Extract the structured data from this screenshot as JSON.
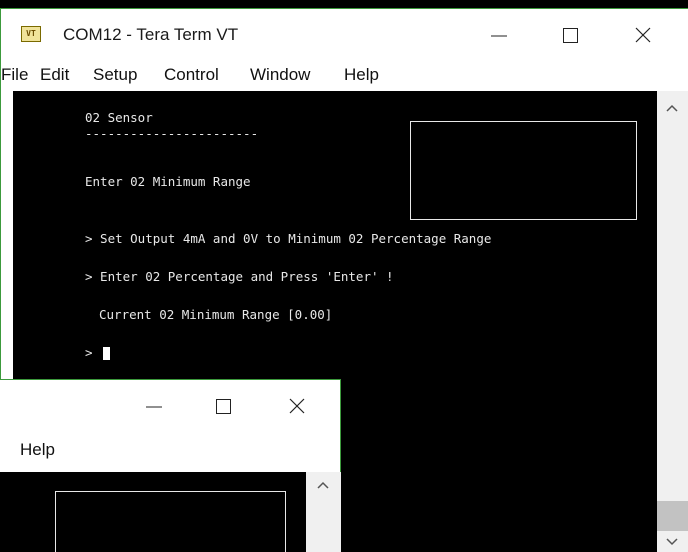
{
  "window": {
    "icon_text": "VT",
    "title": "COM12 - Tera Term VT"
  },
  "menu": {
    "items": [
      "File",
      "Edit",
      "Setup",
      "Control",
      "Window",
      "Help"
    ]
  },
  "terminal": {
    "lines": [
      "02 Sensor",
      "-----------------------",
      "Enter 02 Minimum Range",
      "> Set Output 4mA and 0V to Minimum 02 Percentage Range",
      "> Enter 02 Percentage and Press 'Enter' !",
      "Current 02 Minimum Range [0.00]",
      ">"
    ]
  },
  "sub_window": {
    "menu_items": [
      "Help"
    ]
  },
  "icons": {
    "app": "tera-term-icon",
    "minimize": "minimize-icon",
    "maximize": "maximize-icon",
    "close": "close-icon",
    "scroll_up": "chevron-up-icon",
    "scroll_down": "chevron-down-icon"
  },
  "colors": {
    "terminal_bg": "#000000",
    "terminal_fg": "#e8e8e8",
    "window_border": "#3c9a3c"
  }
}
